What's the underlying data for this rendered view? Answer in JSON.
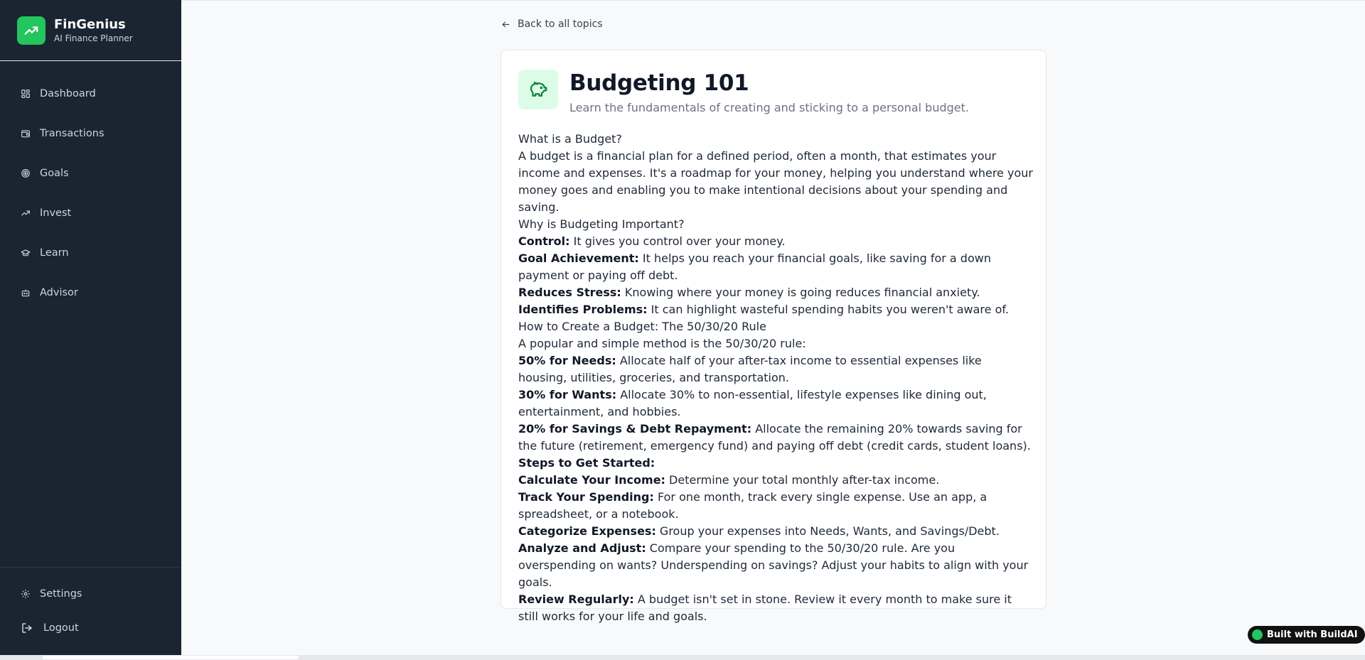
{
  "brand": {
    "name": "FinGenius",
    "subtitle": "AI Finance Planner",
    "logo_icon": "trending-up-icon",
    "accent": "#22c55e"
  },
  "nav": {
    "items": [
      {
        "label": "Dashboard",
        "icon": "grid-icon"
      },
      {
        "label": "Transactions",
        "icon": "wallet-icon"
      },
      {
        "label": "Goals",
        "icon": "target-icon"
      },
      {
        "label": "Invest",
        "icon": "trending-up-icon"
      },
      {
        "label": "Learn",
        "icon": "graduation-cap-icon"
      },
      {
        "label": "Advisor",
        "icon": "bot-icon"
      }
    ],
    "bottom": [
      {
        "label": "Settings",
        "icon": "gear-icon"
      },
      {
        "label": "Logout",
        "icon": "logout-icon"
      }
    ]
  },
  "back_link": "Back to all topics",
  "topic": {
    "title": "Budgeting 101",
    "description": "Learn the fundamentals of creating and sticking to a personal budget.",
    "icon": "piggy-bank-icon"
  },
  "content": [
    {
      "bold": "",
      "text": "What is a Budget?"
    },
    {
      "bold": "",
      "text": "A budget is a financial plan for a defined period, often a month, that estimates your income and expenses. It's a roadmap for your money, helping you understand where your money goes and enabling you to make intentional decisions about your spending and saving."
    },
    {
      "bold": "",
      "text": "Why is Budgeting Important?"
    },
    {
      "bold": "Control:",
      "text": " It gives you control over your money."
    },
    {
      "bold": "Goal Achievement:",
      "text": " It helps you reach your financial goals, like saving for a down payment or paying off debt."
    },
    {
      "bold": "Reduces Stress:",
      "text": " Knowing where your money is going reduces financial anxiety."
    },
    {
      "bold": "Identifies Problems:",
      "text": " It can highlight wasteful spending habits you weren't aware of."
    },
    {
      "bold": "",
      "text": "How to Create a Budget: The 50/30/20 Rule"
    },
    {
      "bold": "",
      "text": "A popular and simple method is the 50/30/20 rule:"
    },
    {
      "bold": "50% for Needs:",
      "text": " Allocate half of your after-tax income to essential expenses like housing, utilities, groceries, and transportation."
    },
    {
      "bold": "30% for Wants:",
      "text": " Allocate 30% to non-essential, lifestyle expenses like dining out, entertainment, and hobbies."
    },
    {
      "bold": "20% for Savings & Debt Repayment:",
      "text": " Allocate the remaining 20% towards saving for the future (retirement, emergency fund) and paying off debt (credit cards, student loans)."
    },
    {
      "bold": "Steps to Get Started:",
      "text": ""
    },
    {
      "bold": "Calculate Your Income:",
      "text": " Determine your total monthly after-tax income."
    },
    {
      "bold": "Track Your Spending:",
      "text": " For one month, track every single expense. Use an app, a spreadsheet, or a notebook."
    },
    {
      "bold": "Categorize Expenses:",
      "text": " Group your expenses into Needs, Wants, and Savings/Debt."
    },
    {
      "bold": "Analyze and Adjust:",
      "text": " Compare your spending to the 50/30/20 rule. Are you overspending on wants? Underspending on savings? Adjust your habits to align with your goals."
    },
    {
      "bold": "Review Regularly:",
      "text": " A budget isn't set in stone. Review it every month to make sure it still works for your life and goals."
    }
  ],
  "badge": {
    "prefix": "Built with ",
    "brand": "BuildAI"
  }
}
